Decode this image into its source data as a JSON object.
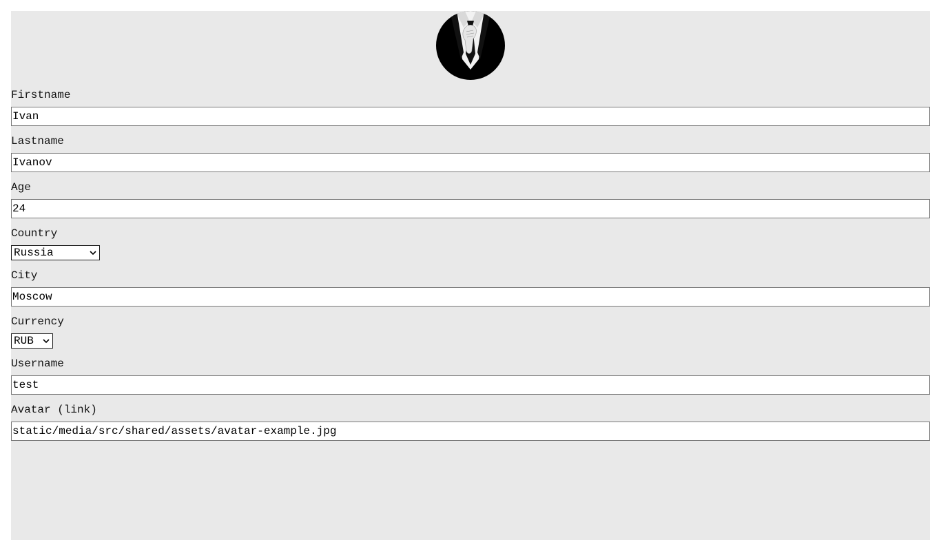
{
  "avatar": {
    "icon": "suited-man-avatar"
  },
  "fields": {
    "firstname": {
      "label": "Firstname",
      "value": "Ivan"
    },
    "lastname": {
      "label": "Lastname",
      "value": "Ivanov"
    },
    "age": {
      "label": "Age",
      "value": "24"
    },
    "country": {
      "label": "Country",
      "value": "Russia"
    },
    "city": {
      "label": "City",
      "value": "Moscow"
    },
    "currency": {
      "label": "Currency",
      "value": "RUB"
    },
    "username": {
      "label": "Username",
      "value": "test"
    },
    "avatar_link": {
      "label": "Avatar (link)",
      "value": "static/media/src/shared/assets/avatar-example.jpg"
    }
  },
  "colors": {
    "panel_bg": "#e9e9e9",
    "field_border": "#767676"
  }
}
